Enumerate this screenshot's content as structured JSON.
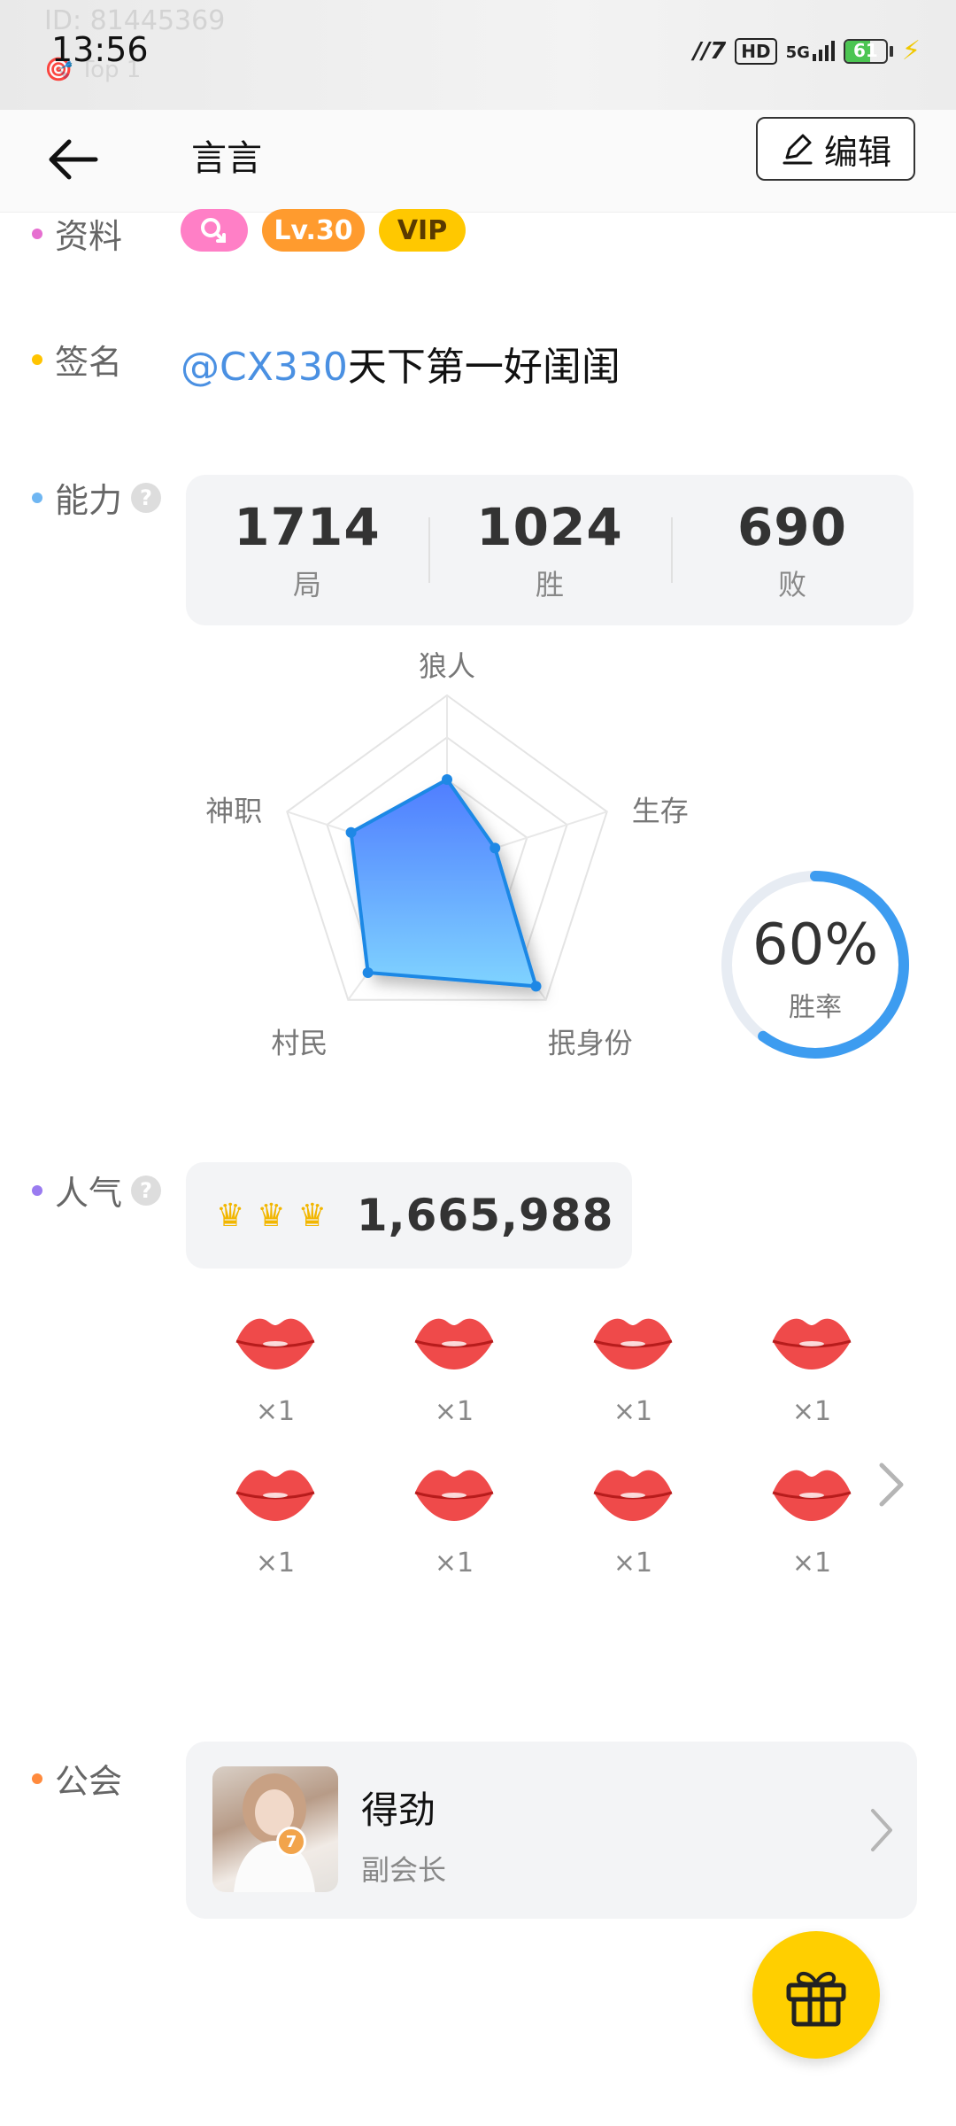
{
  "status_bar": {
    "time": "13:56",
    "network": "HD",
    "signal": "5G",
    "battery_level": "61",
    "ghost_id": "ID: 81445369",
    "ghost_line2": "🎯 Top 1"
  },
  "header": {
    "title": "言言",
    "edit_label": "编辑"
  },
  "sections": {
    "profile_label": "资料",
    "signature_label": "签名",
    "ability_label": "能力",
    "popularity_label": "人气",
    "guild_label": "公会"
  },
  "badges": {
    "level": "Lv.30",
    "vip": "VIP"
  },
  "signature": {
    "mention": "@CX330",
    "text": "天下第一好闺闺"
  },
  "stats": [
    {
      "value": "1714",
      "label": "局"
    },
    {
      "value": "1024",
      "label": "胜"
    },
    {
      "value": "690",
      "label": "败"
    }
  ],
  "chart_data": {
    "type": "radar",
    "axes": [
      "狼人",
      "生存",
      "抿身份",
      "村民",
      "神职"
    ],
    "values": [
      0.5,
      0.3,
      0.9,
      0.8,
      0.6
    ],
    "fill_color": "#5b9bff"
  },
  "win_rate": {
    "value": "60%",
    "label": "胜率",
    "fraction": 0.6
  },
  "popularity": {
    "crowns": 3,
    "value": "1,665,988"
  },
  "gifts": [
    {
      "count": "×1"
    },
    {
      "count": "×1"
    },
    {
      "count": "×1"
    },
    {
      "count": "×1"
    },
    {
      "count": "×1"
    },
    {
      "count": "×1"
    },
    {
      "count": "×1"
    },
    {
      "count": "×1"
    }
  ],
  "guild": {
    "name": "得劲",
    "role": "副会长",
    "level": "7"
  },
  "colors": {
    "accent_yellow": "#ffcf00",
    "link_blue": "#4a90e2",
    "dot_profile": "#e66fd0",
    "dot_signature": "#ffc400",
    "dot_ability": "#6fb6f2",
    "dot_popularity": "#9a7bf0",
    "dot_guild": "#ff8a3d"
  }
}
